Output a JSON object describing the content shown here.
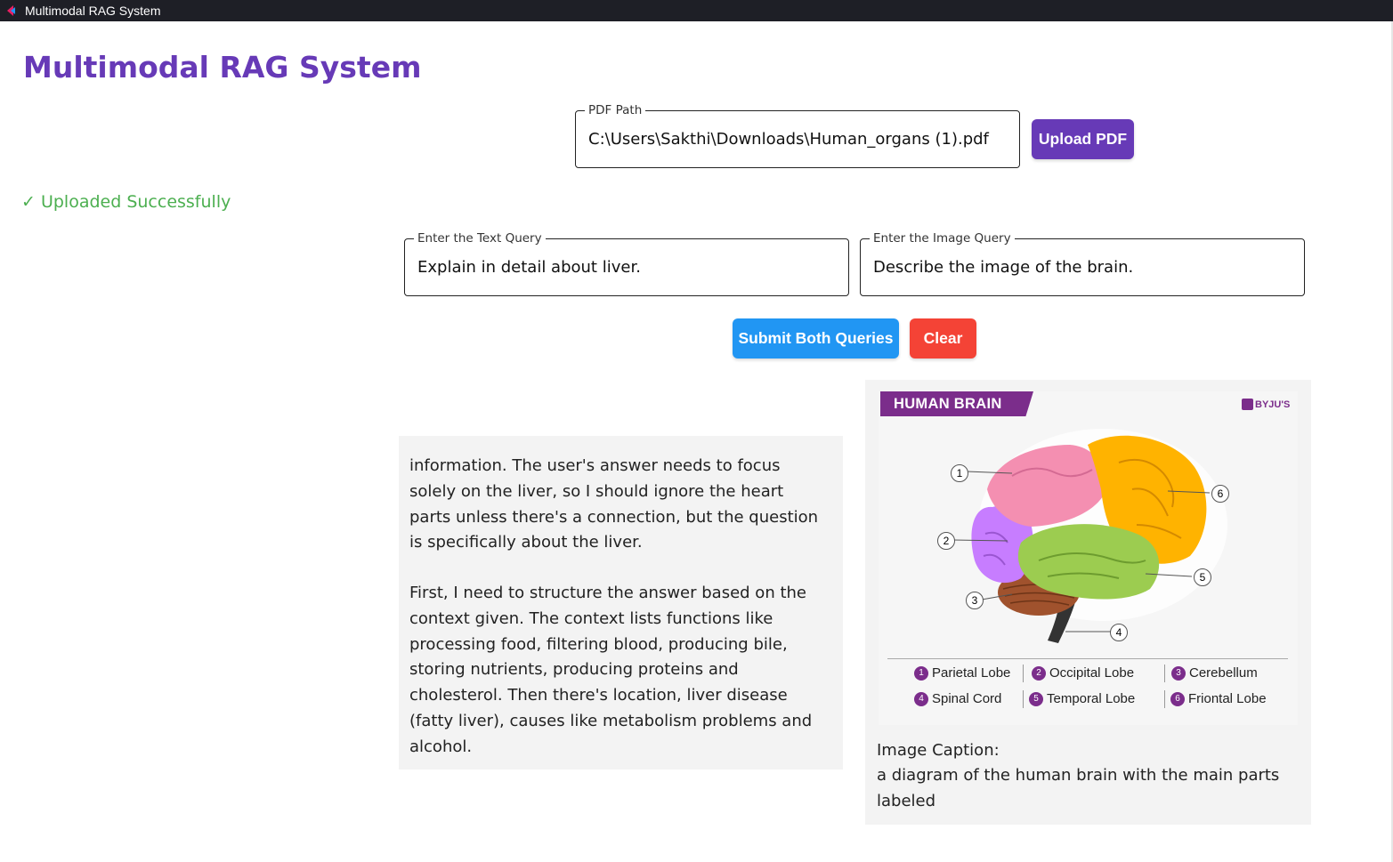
{
  "window": {
    "title": "Multimodal RAG System",
    "icon": "app-chevron-icon"
  },
  "page": {
    "title": "Multimodal RAG System"
  },
  "upload": {
    "pdf_path_label": "PDF Path",
    "pdf_path_value": "C:\\Users\\Sakthi\\Downloads\\Human_organs (1).pdf",
    "upload_button": "Upload PDF",
    "status": "✓ Uploaded Successfully"
  },
  "queries": {
    "text_label": "Enter the Text Query",
    "text_value": "Explain in detail about liver.",
    "image_label": "Enter the Image Query",
    "image_value": "Describe the image of the brain.",
    "submit_button": "Submit Both Queries",
    "clear_button": "Clear"
  },
  "text_answer": {
    "clipped_top_line": ".",
    "paragraph_1": "information. The user's answer needs to focus solely on the liver, so I should ignore the heart parts unless there's a connection, but the question is specifically about the liver.",
    "paragraph_2": "First, I need to structure the answer based on the context given. The context lists functions like processing food, filtering blood, producing bile, storing nutrients, producing proteins and cholesterol. Then there's location, liver disease (fatty liver), causes like metabolism problems and alcohol."
  },
  "image_answer": {
    "diagram": {
      "banner_title": "HUMAN BRAIN",
      "logo": "BYJU'S",
      "callouts": [
        "1",
        "2",
        "3",
        "4",
        "5",
        "6"
      ],
      "legend": [
        {
          "num": "1",
          "label": "Parietal Lobe"
        },
        {
          "num": "2",
          "label": "Occipital Lobe"
        },
        {
          "num": "3",
          "label": "Cerebellum"
        },
        {
          "num": "4",
          "label": "Spinal Cord"
        },
        {
          "num": "5",
          "label": "Temporal Lobe"
        },
        {
          "num": "6",
          "label": "Friontal Lobe"
        }
      ],
      "region_colors": {
        "parietal": "#f48fb1",
        "occipital": "#c77dff",
        "frontal": "#ffb300",
        "temporal": "#9ccc50",
        "cerebellum": "#a0522d",
        "spinal_cord": "#333333"
      }
    },
    "caption_title": "Image Caption:",
    "caption_text": "a diagram of the human brain with the main parts labeled"
  },
  "colors": {
    "title": "#673ab7",
    "upload_button": "#673ab7",
    "submit_button": "#2196f3",
    "clear_button": "#f44336",
    "status": "#4caf50"
  }
}
